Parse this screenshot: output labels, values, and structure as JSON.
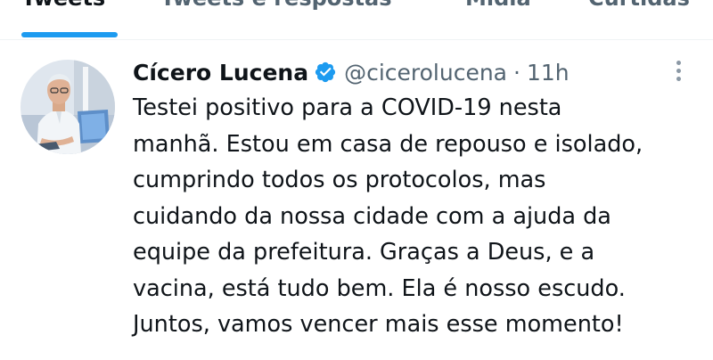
{
  "tabs": [
    {
      "label": "Tweets",
      "active": true
    },
    {
      "label": "Tweets e respostas",
      "active": false
    },
    {
      "label": "Mídia",
      "active": false
    },
    {
      "label": "Curtidas",
      "active": false
    }
  ],
  "tweet": {
    "author_name": "Cícero Lucena",
    "handle": "@cicerolucena",
    "separator": "·",
    "time": "11h",
    "verified": true,
    "text": "Testei positivo para a COVID-19 nesta\nmanhã. Estou em casa de repouso e isolado,\ncumprindo todos os protocolos, mas\ncuidando da nossa cidade com a ajuda da\nequipe da prefeitura. Graças a Deus, e a\nvacina, está tudo bem. Ela é nosso escudo.\nJuntos, vamos vencer mais esse momento!"
  },
  "icons": {
    "verified": "verified-badge-icon",
    "more": "more-options-icon"
  },
  "colors": {
    "accent": "#1d9bf0",
    "text": "#0f1419",
    "secondary": "#536471",
    "divider": "#eff3f4"
  }
}
